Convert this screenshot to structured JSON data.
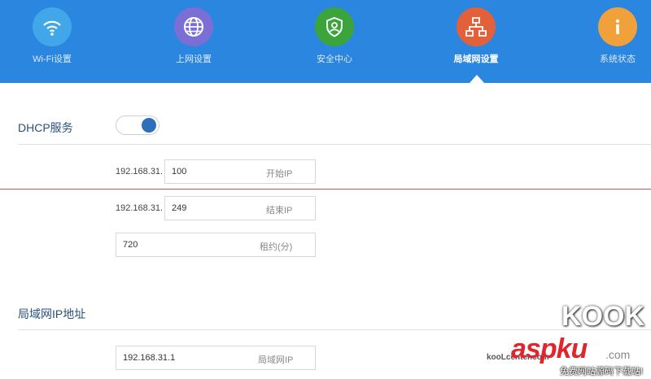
{
  "nav": {
    "items": [
      {
        "label": "Wi-Fi设置",
        "icon": "wifi-icon",
        "color": "#41a7e8"
      },
      {
        "label": "上网设置",
        "icon": "globe-icon",
        "color": "#7b6fd6"
      },
      {
        "label": "安全中心",
        "icon": "shield-user-icon",
        "color": "#3ba53c"
      },
      {
        "label": "局域网设置",
        "icon": "lan-icon",
        "color": "#e2603a",
        "active": true
      },
      {
        "label": "系统状态",
        "icon": "info-icon",
        "color": "#f0a13a"
      }
    ],
    "background": "#2b86e0"
  },
  "dhcp": {
    "title": "DHCP服务",
    "enabled": true,
    "start": {
      "prefix": "192.168.31.",
      "value": "100",
      "hint": "开始IP"
    },
    "end": {
      "prefix": "192.168.31.",
      "value": "249",
      "hint": "结束IP"
    },
    "lease": {
      "value": "720",
      "hint": "租约(分)"
    }
  },
  "lan": {
    "title": "局域网IP地址",
    "ip": {
      "value": "192.168.31.1",
      "hint": "局域网IP"
    }
  },
  "watermark": {
    "site1": "kooLcenter.com",
    "aspku": "aspku",
    "dotcom": ".com",
    "slogan": "免费网站源码下载站!",
    "logo": "KOOK"
  }
}
